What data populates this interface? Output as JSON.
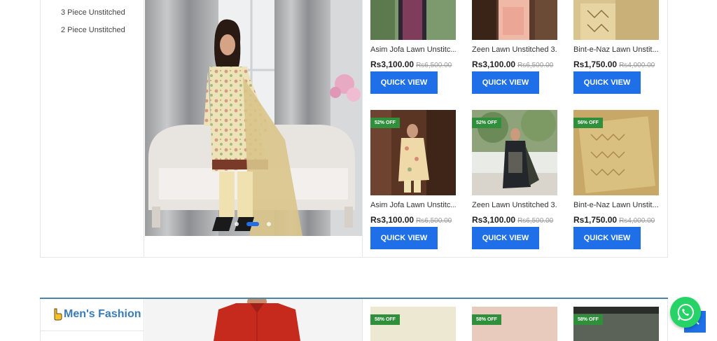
{
  "sidebar": {
    "links": [
      {
        "label": "3 Piece Unstitched"
      },
      {
        "label": "2 Piece Unstitched"
      }
    ]
  },
  "colors": {
    "accent": "#1e6fe8",
    "badge": "#2f8f3a",
    "section_heading": "#3b7bb8",
    "whatsapp": "#25d366"
  },
  "products": [
    {
      "name": "Asim Jofa Lawn Unstitc...",
      "price": "Rs3,100.00",
      "old_price": "Rs6,500.00",
      "button": "QUICK VIEW"
    },
    {
      "name": "Zeen Lawn Unstitched 3...",
      "price": "Rs3,100.00",
      "old_price": "Rs6,500.00",
      "button": "QUICK VIEW"
    },
    {
      "name": "Bint-e-Naz Lawn Unstit...",
      "price": "Rs1,750.00",
      "old_price": "Rs4,000.00",
      "button": "QUICK VIEW"
    },
    {
      "badge": "52% OFF",
      "name": "Asim Jofa Lawn Unstitc...",
      "price": "Rs3,100.00",
      "old_price": "Rs6,500.00",
      "button": "QUICK VIEW"
    },
    {
      "badge": "52% OFF",
      "name": "Zeen Lawn Unstitched 3...",
      "price": "Rs3,100.00",
      "old_price": "Rs6,500.00",
      "button": "QUICK VIEW"
    },
    {
      "badge": "56% OFF",
      "name": "Bint-e-Naz Lawn Unstit...",
      "price": "Rs1,750.00",
      "old_price": "Rs4,000.00",
      "button": "QUICK VIEW"
    }
  ],
  "carousel": {
    "slides": 3,
    "active": 1
  },
  "mens": {
    "title": "Men's Fashion",
    "badges": [
      "58% OFF",
      "58% OFF",
      "58% OFF"
    ]
  },
  "icons": {
    "whatsapp": "whatsapp-icon",
    "back_to_top": "chevron-up-icon",
    "heading": "pointing-hand-icon"
  }
}
